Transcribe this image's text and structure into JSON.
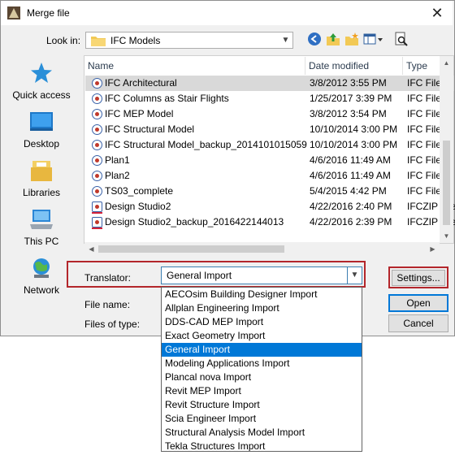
{
  "window": {
    "title": "Merge file"
  },
  "lookin": {
    "label": "Look in:",
    "value": "IFC Models"
  },
  "toolbar": {
    "icons": [
      "back-icon",
      "up-folder-icon",
      "new-folder-icon",
      "view-menu-icon",
      "preview-icon"
    ]
  },
  "places": [
    {
      "label": "Quick access",
      "icon": "star-icon"
    },
    {
      "label": "Desktop",
      "icon": "desktop-icon"
    },
    {
      "label": "Libraries",
      "icon": "libraries-icon"
    },
    {
      "label": "This PC",
      "icon": "computer-icon"
    },
    {
      "label": "Network",
      "icon": "network-icon"
    }
  ],
  "columns": {
    "name": "Name",
    "date": "Date modified",
    "type": "Type"
  },
  "files": [
    {
      "name": "IFC Architectural",
      "date": "3/8/2012 3:55 PM",
      "type": "IFC Files",
      "kind": "ifc",
      "selected": true
    },
    {
      "name": "IFC Columns as Stair Flights",
      "date": "1/25/2017 3:39 PM",
      "type": "IFC Files",
      "kind": "ifc"
    },
    {
      "name": "IFC MEP Model",
      "date": "3/8/2012 3:54 PM",
      "type": "IFC Files",
      "kind": "ifc"
    },
    {
      "name": "IFC Structural Model",
      "date": "10/10/2014 3:00 PM",
      "type": "IFC Files",
      "kind": "ifc"
    },
    {
      "name": "IFC Structural Model_backup_2014101015059",
      "date": "10/10/2014 3:00 PM",
      "type": "IFC Files",
      "kind": "ifc"
    },
    {
      "name": "Plan1",
      "date": "4/6/2016 11:49 AM",
      "type": "IFC Files",
      "kind": "ifc"
    },
    {
      "name": "Plan2",
      "date": "4/6/2016 11:49 AM",
      "type": "IFC Files",
      "kind": "ifc"
    },
    {
      "name": "TS03_complete",
      "date": "5/4/2015 4:42 PM",
      "type": "IFC Files",
      "kind": "ifc"
    },
    {
      "name": "Design Studio2",
      "date": "4/22/2016 2:40 PM",
      "type": "IFCZIP Files",
      "kind": "zip"
    },
    {
      "name": "Design Studio2_backup_2016422144013",
      "date": "4/22/2016 2:39 PM",
      "type": "IFCZIP Files",
      "kind": "zip"
    }
  ],
  "translator": {
    "label": "Translator:",
    "value": "General Import",
    "options": [
      "AECOsim Building Designer Import",
      "Allplan Engineering Import",
      "DDS-CAD MEP Import",
      "Exact Geometry Import",
      "General Import",
      "Modeling Applications Import",
      "Plancal nova Import",
      "Revit MEP Import",
      "Revit Structure Import",
      "Scia Engineer Import",
      "Structural Analysis Model Import",
      "Tekla Structures Import"
    ],
    "selected_index": 4
  },
  "fields": {
    "filename_label": "File name:",
    "filetype_label": "Files of type:"
  },
  "buttons": {
    "settings": "Settings...",
    "open": "Open",
    "cancel": "Cancel"
  },
  "colors": {
    "highlight_frame": "#b3262b",
    "selection": "#0078d7"
  }
}
